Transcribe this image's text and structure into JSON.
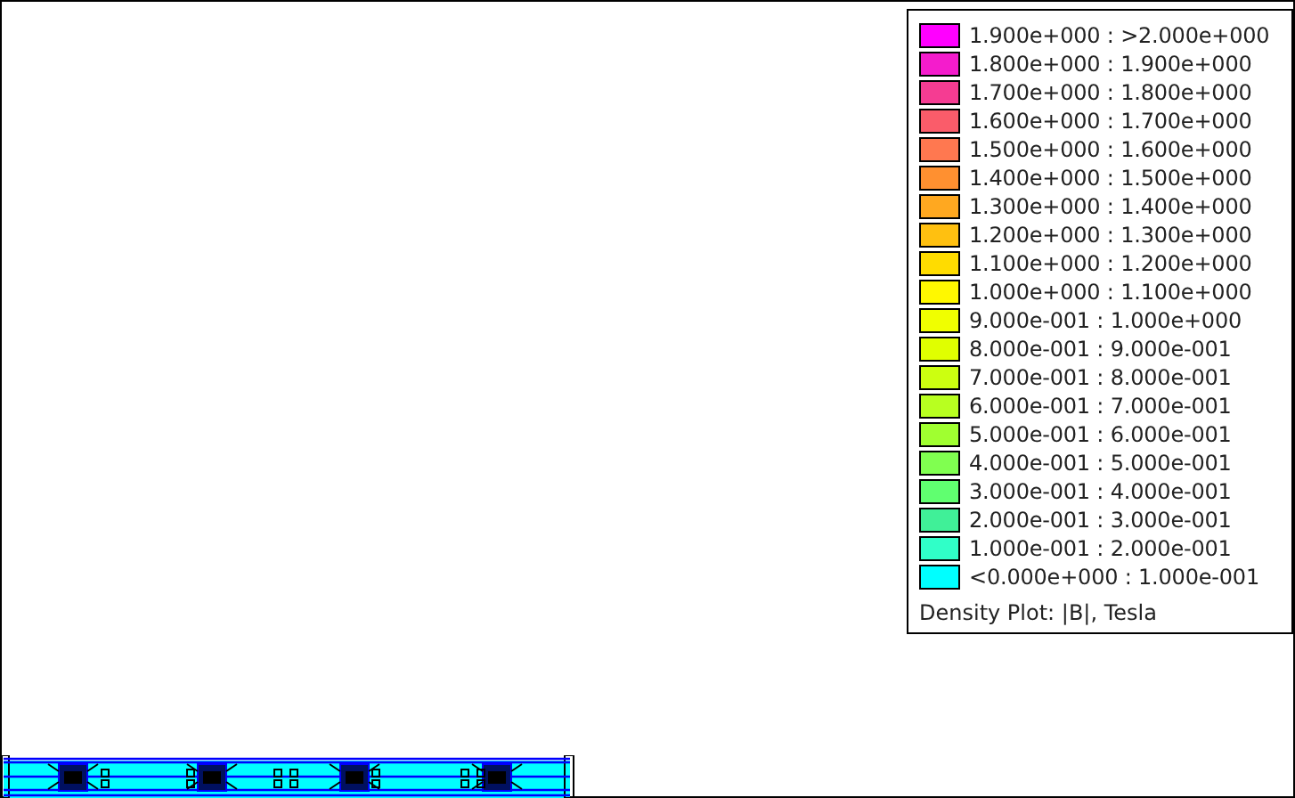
{
  "legend": {
    "items": [
      {
        "label": "1.900e+000 : >2.000e+000",
        "color": "#ff00ff"
      },
      {
        "label": "1.800e+000 : 1.900e+000",
        "color": "#f41ccc"
      },
      {
        "label": "1.700e+000 : 1.800e+000",
        "color": "#f53c92"
      },
      {
        "label": "1.600e+000 : 1.700e+000",
        "color": "#fa5c6a"
      },
      {
        "label": "1.500e+000 : 1.600e+000",
        "color": "#ff7850"
      },
      {
        "label": "1.400e+000 : 1.500e+000",
        "color": "#ff9030"
      },
      {
        "label": "1.300e+000 : 1.400e+000",
        "color": "#ffa820"
      },
      {
        "label": "1.200e+000 : 1.300e+000",
        "color": "#ffc010"
      },
      {
        "label": "1.100e+000 : 1.200e+000",
        "color": "#ffdc00"
      },
      {
        "label": "1.000e+000 : 1.100e+000",
        "color": "#fff800"
      },
      {
        "label": "9.000e-001 : 1.000e+000",
        "color": "#f0ff00"
      },
      {
        "label": "8.000e-001 : 9.000e-001",
        "color": "#e0ff00"
      },
      {
        "label": "7.000e-001 : 8.000e-001",
        "color": "#ccff10"
      },
      {
        "label": "6.000e-001 : 7.000e-001",
        "color": "#b8ff20"
      },
      {
        "label": "5.000e-001 : 6.000e-001",
        "color": "#a0ff30"
      },
      {
        "label": "4.000e-001 : 5.000e-001",
        "color": "#80ff50"
      },
      {
        "label": "3.000e-001 : 4.000e-001",
        "color": "#60ff70"
      },
      {
        "label": "2.000e-001 : 3.000e-001",
        "color": "#40f098"
      },
      {
        "label": "1.000e-001 : 2.000e-001",
        "color": "#30ffc8"
      },
      {
        "label": "<0.000e+000 : 1.000e-001",
        "color": "#00ffff"
      }
    ],
    "caption": "Density Plot: |B|, Tesla"
  }
}
